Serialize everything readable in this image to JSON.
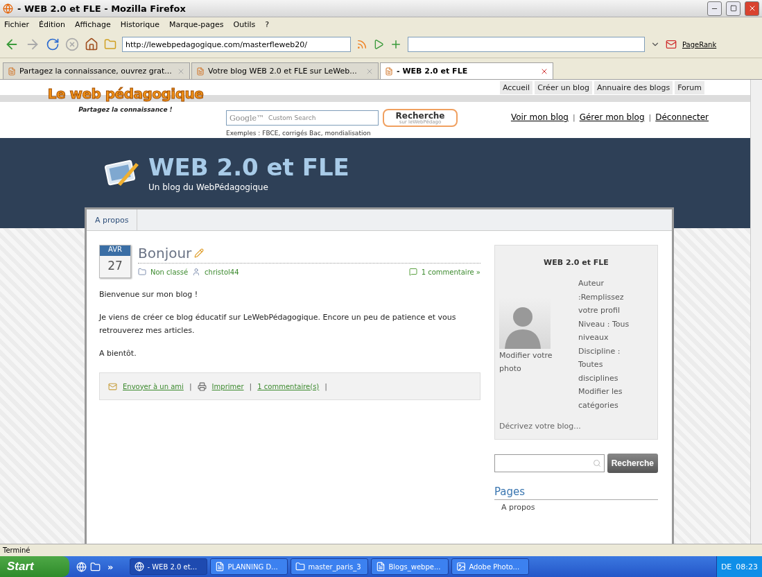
{
  "window": {
    "title": "- WEB 2.0 et FLE - Mozilla Firefox"
  },
  "menu": [
    "Fichier",
    "Édition",
    "Affichage",
    "Historique",
    "Marque-pages",
    "Outils",
    "?"
  ],
  "toolbar": {
    "url": "http://lewebpedagogique.com/masterfleweb20/",
    "pagerank": "PageRank"
  },
  "tabs": [
    {
      "label": "Partagez la connaissance, ouvrez grat...",
      "selected": false
    },
    {
      "label": "Votre blog WEB 2.0 et FLE sur LeWeb...",
      "selected": false
    },
    {
      "label": "- WEB 2.0 et FLE",
      "selected": true
    }
  ],
  "site": {
    "logo": "Le web pédagogique",
    "tagline": "Partagez la connaissance !",
    "top_nav": [
      "Accueil",
      "Créer un blog",
      "Annuaire des blogs",
      "Forum"
    ],
    "search_brand": "Google™",
    "search_placeholder": "Custom Search",
    "search_button": "Recherche",
    "search_button_sub": "sur leWebPédago",
    "examples": "Exemples : FBCE, corrigés Bac, mondialisation",
    "user_links": [
      "Voir mon blog",
      "Gérer mon blog",
      "Déconnecter"
    ],
    "separator": "|"
  },
  "blog": {
    "title": "WEB 2.0 et FLE",
    "subtitle": "Un blog du WebPédagogique",
    "nav": [
      {
        "label": "A propos",
        "selected": false
      }
    ]
  },
  "post": {
    "month": "AVR",
    "day": "27",
    "title": "Bonjour",
    "category": "Non classé",
    "author": "christol44",
    "comments": "1 commentaire »",
    "separator": "|",
    "paragraphs": [
      "Bienvenue sur mon blog !",
      "Je viens de créer ce blog éducatif sur LeWebPédagogique. Encore un peu de patience et vous retrouverez mes articles.",
      "A bientôt."
    ],
    "actions": [
      {
        "kind": "mail",
        "label": "Envoyer à un ami"
      },
      {
        "kind": "print",
        "label": "Imprimer"
      },
      {
        "kind": "plain",
        "label": "1 commentaire(s)"
      }
    ]
  },
  "sidebar": {
    "title": "WEB 2.0 et FLE",
    "photo_link": "Modifier votre photo",
    "profile": [
      "Auteur :Remplissez votre profil",
      "Niveau : Tous niveaux",
      "Discipline : Toutes disciplines",
      "Modifier les catégories"
    ],
    "describe": "Décrivez votre blog...",
    "search_button": "Recherche",
    "pages_heading": "Pages",
    "pages": [
      "A propos"
    ]
  },
  "status": "Terminé",
  "taskbar": {
    "start": "Start",
    "more": "»",
    "tasks": [
      {
        "label": "- WEB 2.0 et...",
        "kind": "browser",
        "selected": true
      },
      {
        "label": "PLANNING D...",
        "kind": "doc",
        "selected": false
      },
      {
        "label": "master_paris_3",
        "kind": "folder",
        "selected": false
      },
      {
        "label": "Blogs_webpe...",
        "kind": "doc",
        "selected": false
      },
      {
        "label": "Adobe Photo...",
        "kind": "app",
        "selected": false
      }
    ],
    "language": "DE",
    "clock": "08:23"
  }
}
